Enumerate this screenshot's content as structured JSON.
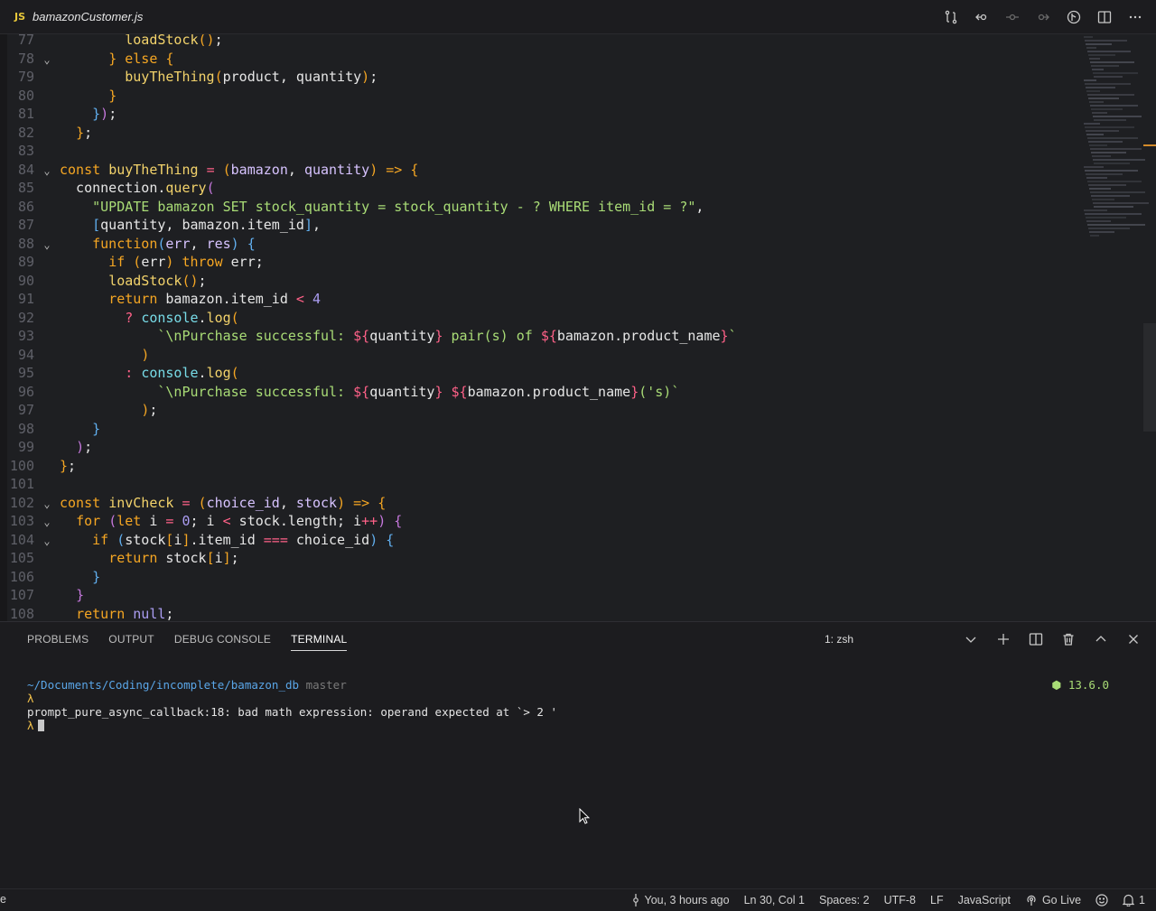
{
  "tab": {
    "badge": "JS",
    "filename": "bamazonCustomer.js"
  },
  "editor": {
    "lines": [
      {
        "n": "77",
        "fold": false,
        "html": "        <span class='fn'>loadStock</span><span class='br1'>()</span>;"
      },
      {
        "n": "78",
        "fold": true,
        "html": "      <span class='br1'>}</span> <span class='kw'>else</span> <span class='br1'>{</span>"
      },
      {
        "n": "79",
        "fold": false,
        "html": "        <span class='fn'>buyTheThing</span><span class='br1'>(</span>product, quantity<span class='br1'>)</span>;"
      },
      {
        "n": "80",
        "fold": false,
        "html": "      <span class='br1'>}</span>"
      },
      {
        "n": "81",
        "fold": false,
        "html": "    <span class='br3'>}</span><span class='br2'>)</span>;"
      },
      {
        "n": "82",
        "fold": false,
        "html": "  <span class='br1'>}</span>;"
      },
      {
        "n": "83",
        "fold": false,
        "html": ""
      },
      {
        "n": "84",
        "fold": true,
        "html": "<span class='kw'>const</span> <span class='fn'>buyTheThing</span> <span class='op'>=</span> <span class='br1'>(</span><span class='prm'>bamazon</span>, <span class='prm'>quantity</span><span class='br1'>)</span> <span class='kw'>=&gt;</span> <span class='br1'>{</span>"
      },
      {
        "n": "85",
        "fold": false,
        "html": "  connection.<span class='fn'>query</span><span class='br2'>(</span>"
      },
      {
        "n": "86",
        "fold": false,
        "html": "    <span class='str'>\"UPDATE bamazon SET stock_quantity = stock_quantity - ? WHERE item_id = ?\"</span>,"
      },
      {
        "n": "87",
        "fold": false,
        "html": "    <span class='br3'>[</span>quantity, bamazon.item_id<span class='br3'>]</span>,"
      },
      {
        "n": "88",
        "fold": true,
        "html": "    <span class='kw'>function</span><span class='br3'>(</span><span class='prm'>err</span>, <span class='prm'>res</span><span class='br3'>)</span> <span class='br3'>{</span>"
      },
      {
        "n": "89",
        "fold": false,
        "html": "      <span class='kw'>if</span> <span class='br1'>(</span>err<span class='br1'>)</span> <span class='kw'>throw</span> err;"
      },
      {
        "n": "90",
        "fold": false,
        "html": "      <span class='fn'>loadStock</span><span class='br1'>()</span>;"
      },
      {
        "n": "91",
        "fold": false,
        "html": "      <span class='kw'>return</span> bamazon.item_id <span class='op'>&lt;</span> <span class='num'>4</span>"
      },
      {
        "n": "92",
        "fold": false,
        "html": "        <span class='op'>?</span> <span class='obj'>console</span>.<span class='fn'>log</span><span class='br1'>(</span>"
      },
      {
        "n": "93",
        "fold": false,
        "html": "            <span class='str'>`\\nPurchase successful: </span><span class='op'>${</span>quantity<span class='op'>}</span><span class='str'> pair(s) of </span><span class='op'>${</span>bamazon.product_name<span class='op'>}</span><span class='str'>`</span>"
      },
      {
        "n": "94",
        "fold": false,
        "html": "          <span class='br1'>)</span>"
      },
      {
        "n": "95",
        "fold": false,
        "html": "        <span class='op'>:</span> <span class='obj'>console</span>.<span class='fn'>log</span><span class='br1'>(</span>"
      },
      {
        "n": "96",
        "fold": false,
        "html": "            <span class='str'>`\\nPurchase successful: </span><span class='op'>${</span>quantity<span class='op'>}</span><span class='str'> </span><span class='op'>${</span>bamazon.product_name<span class='op'>}</span><span class='str'>('s)`</span>"
      },
      {
        "n": "97",
        "fold": false,
        "html": "          <span class='br1'>)</span>;"
      },
      {
        "n": "98",
        "fold": false,
        "html": "    <span class='br3'>}</span>"
      },
      {
        "n": "99",
        "fold": false,
        "html": "  <span class='br2'>)</span>;"
      },
      {
        "n": "100",
        "fold": false,
        "html": "<span class='br1'>}</span>;"
      },
      {
        "n": "101",
        "fold": false,
        "html": ""
      },
      {
        "n": "102",
        "fold": true,
        "html": "<span class='kw'>const</span> <span class='fn'>invCheck</span> <span class='op'>=</span> <span class='br1'>(</span><span class='prm'>choice_id</span>, <span class='prm'>stock</span><span class='br1'>)</span> <span class='kw'>=&gt;</span> <span class='br1'>{</span>"
      },
      {
        "n": "103",
        "fold": true,
        "html": "  <span class='kw'>for</span> <span class='br2'>(</span><span class='kw'>let</span> i <span class='op'>=</span> <span class='num'>0</span>; i <span class='op'>&lt;</span> stock.length; i<span class='op'>++</span><span class='br2'>)</span> <span class='br2'>{</span>"
      },
      {
        "n": "104",
        "fold": true,
        "html": "    <span class='kw'>if</span> <span class='br3'>(</span>stock<span class='br1'>[</span>i<span class='br1'>]</span>.item_id <span class='op'>===</span> choice_id<span class='br3'>)</span> <span class='br3'>{</span>"
      },
      {
        "n": "105",
        "fold": false,
        "html": "      <span class='kw'>return</span> stock<span class='br1'>[</span>i<span class='br1'>]</span>;"
      },
      {
        "n": "106",
        "fold": false,
        "html": "    <span class='br3'>}</span>"
      },
      {
        "n": "107",
        "fold": false,
        "html": "  <span class='br2'>}</span>"
      },
      {
        "n": "108",
        "fold": false,
        "html": "  <span class='kw'>return</span> <span class='num'>null</span>;"
      }
    ]
  },
  "panel": {
    "tabs": [
      "PROBLEMS",
      "OUTPUT",
      "DEBUG CONSOLE",
      "TERMINAL"
    ],
    "active_tab": "TERMINAL",
    "terminal_select": "1: zsh",
    "terminal": {
      "path": "~/Documents/Coding/incomplete/bamazon_db",
      "branch": "master",
      "prompt": "λ",
      "error": "prompt_pure_async_callback:18: bad math expression: operand expected at `> 2 '",
      "node_version": "13.6.0"
    }
  },
  "status": {
    "left": "e",
    "blame": "You, 3 hours ago",
    "position": "Ln 30, Col 1",
    "spaces": "Spaces: 2",
    "encoding": "UTF-8",
    "eol": "LF",
    "language": "JavaScript",
    "go_live": "Go Live",
    "notifications": "1"
  }
}
